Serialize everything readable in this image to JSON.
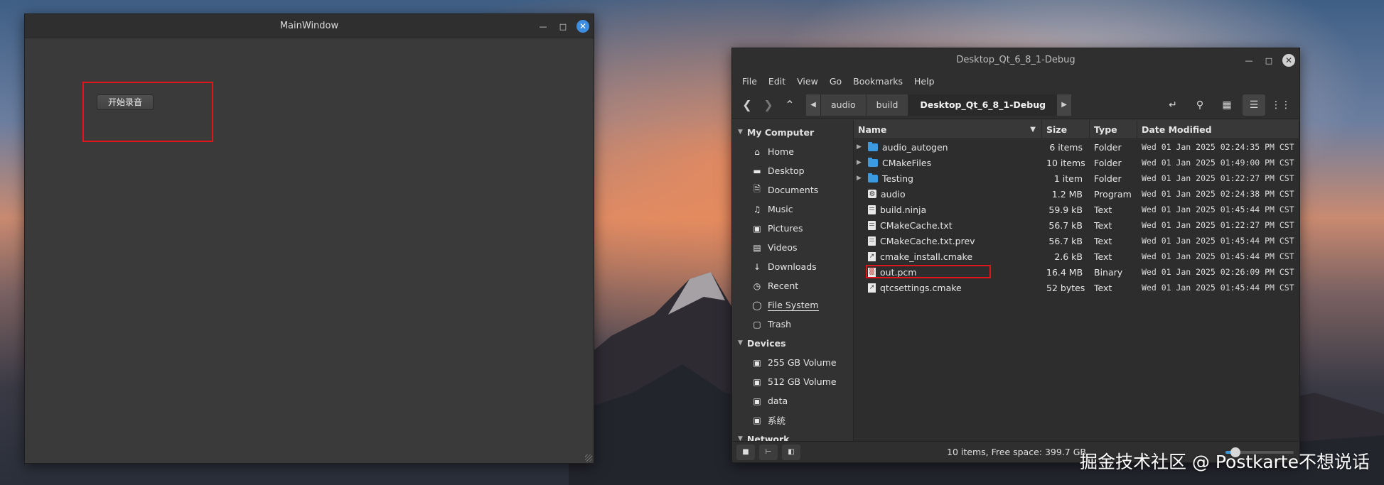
{
  "main_window": {
    "title": "MainWindow",
    "start_button_label": "开始录音"
  },
  "file_manager": {
    "title": "Desktop_Qt_6_8_1-Debug",
    "menu": [
      "File",
      "Edit",
      "View",
      "Go",
      "Bookmarks",
      "Help"
    ],
    "breadcrumbs": [
      "audio",
      "build",
      "Desktop_Qt_6_8_1-Debug"
    ],
    "sidebar": {
      "my_computer": {
        "heading": "My Computer",
        "items": [
          "Home",
          "Desktop",
          "Documents",
          "Music",
          "Pictures",
          "Videos",
          "Downloads",
          "Recent",
          "File System",
          "Trash"
        ]
      },
      "devices": {
        "heading": "Devices",
        "items": [
          "255 GB Volume",
          "512 GB Volume",
          "data",
          "系统"
        ]
      },
      "network": {
        "heading": "Network"
      }
    },
    "columns": {
      "name": "Name",
      "size": "Size",
      "type": "Type",
      "modified": "Date Modified"
    },
    "files": [
      {
        "name": "audio_autogen",
        "size": "6 items",
        "type": "Folder",
        "modified": "Wed 01 Jan 2025 02:24:35 PM CST",
        "icon": "folder-icon",
        "expandable": true
      },
      {
        "name": "CMakeFiles",
        "size": "10 items",
        "type": "Folder",
        "modified": "Wed 01 Jan 2025 01:49:00 PM CST",
        "icon": "folder-icon",
        "expandable": true
      },
      {
        "name": "Testing",
        "size": "1 item",
        "type": "Folder",
        "modified": "Wed 01 Jan 2025 01:22:27 PM CST",
        "icon": "folder-icon",
        "expandable": true
      },
      {
        "name": "audio",
        "size": "1.2 MB",
        "type": "Program",
        "modified": "Wed 01 Jan 2025 02:24:38 PM CST",
        "icon": "program-icon",
        "expandable": false
      },
      {
        "name": "build.ninja",
        "size": "59.9 kB",
        "type": "Text",
        "modified": "Wed 01 Jan 2025 01:45:44 PM CST",
        "icon": "text-file-icon",
        "expandable": false
      },
      {
        "name": "CMakeCache.txt",
        "size": "56.7 kB",
        "type": "Text",
        "modified": "Wed 01 Jan 2025 01:22:27 PM CST",
        "icon": "text-file-icon",
        "expandable": false
      },
      {
        "name": "CMakeCache.txt.prev",
        "size": "56.7 kB",
        "type": "Text",
        "modified": "Wed 01 Jan 2025 01:45:44 PM CST",
        "icon": "text-file-icon",
        "expandable": false
      },
      {
        "name": "cmake_install.cmake",
        "size": "2.6 kB",
        "type": "Text",
        "modified": "Wed 01 Jan 2025 01:45:44 PM CST",
        "icon": "script-file-icon",
        "expandable": false
      },
      {
        "name": "out.pcm",
        "size": "16.4 MB",
        "type": "Binary",
        "modified": "Wed 01 Jan 2025 02:26:09 PM CST",
        "icon": "binary-file-icon",
        "expandable": false
      },
      {
        "name": "qtcsettings.cmake",
        "size": "52 bytes",
        "type": "Text",
        "modified": "Wed 01 Jan 2025 01:45:44 PM CST",
        "icon": "script-file-icon",
        "expandable": false
      }
    ],
    "status": "10 items, Free space: 399.7 GB",
    "zoom_level": 0.15,
    "colors": {
      "accent": "#3c9be0",
      "highlight": "#e0141c"
    }
  },
  "watermark": "掘金技术社区 @ Postkarte不想说话"
}
